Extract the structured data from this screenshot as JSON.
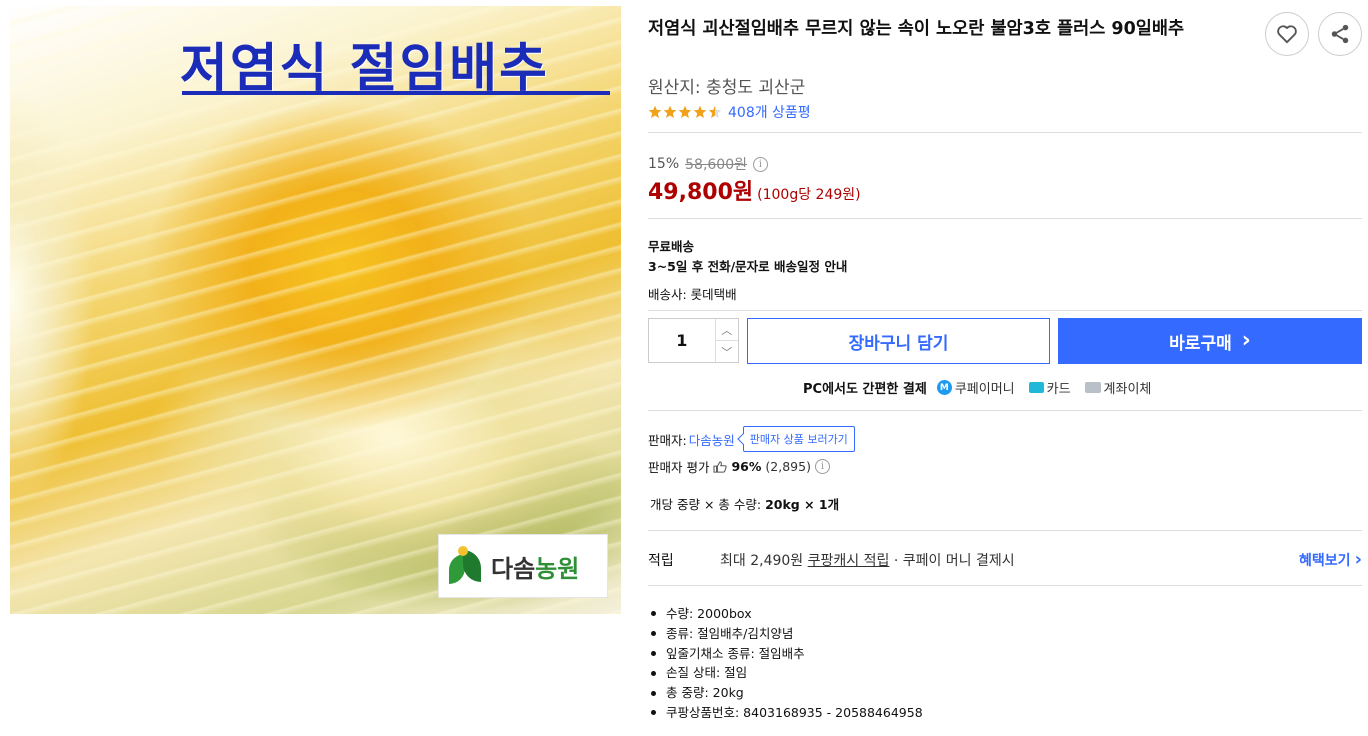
{
  "image": {
    "overlay_title": "저염식 절임배추",
    "brand_prefix": "다솜",
    "brand_accent": "농원"
  },
  "product": {
    "title": "저염식 괴산절임배추 무르지 않는 속이 노오란 불암3호 플러스 90일배추",
    "origin": "원산지: 충청도 괴산군",
    "rating": 4.5,
    "review_count": "408개 상품평"
  },
  "price": {
    "discount_rate": "15%",
    "original_price": "58,600원",
    "info_icon": "i",
    "sale_price": "49,800원",
    "unit_price": "(100g당 249원)"
  },
  "shipping": {
    "free": "무료배송",
    "note": "3~5일 후 전화/문자로 배송일정 안내",
    "courier": "배송사: 롯데택배"
  },
  "purchase": {
    "quantity": "1",
    "qty_up": "︿",
    "qty_down": "﹀",
    "cart_label": "장바구니 담기",
    "buy_label": "바로구매",
    "buy_chevron": "›"
  },
  "payment": {
    "lead": "PC에서도 간편한 결제",
    "m_icon_letter": "M",
    "coupay": "쿠페이머니",
    "card": "카드",
    "bank": "계좌이체"
  },
  "seller": {
    "label": "판매자:",
    "name": "다솜농원",
    "more": "판매자 상품 보러가기",
    "rating_label": "판매자 평가",
    "rating_pct": "96%",
    "rating_count": "(2,895)",
    "info_icon": "i"
  },
  "weight": {
    "label": "개당 중량 × 총 수량:",
    "value": "20kg × 1개"
  },
  "reward": {
    "label": "적립",
    "prefix": "최대 2,490원",
    "link": "쿠팡캐시 적립",
    "suffix": "· 쿠페이 머니 결제시",
    "benefit": "혜택보기",
    "benefit_chevron": "›"
  },
  "specs": [
    "수량: 2000box",
    "종류: 절임배추/김치양념",
    "잎줄기채소 종류: 절임배추",
    "손질 상태: 절임",
    "총 중량: 20kg",
    "쿠팡상품번호: 8403168935 - 20588464958"
  ],
  "colors": {
    "accent_blue": "#346aff",
    "price_red": "#ae0000",
    "star_orange": "#f0a21b"
  }
}
